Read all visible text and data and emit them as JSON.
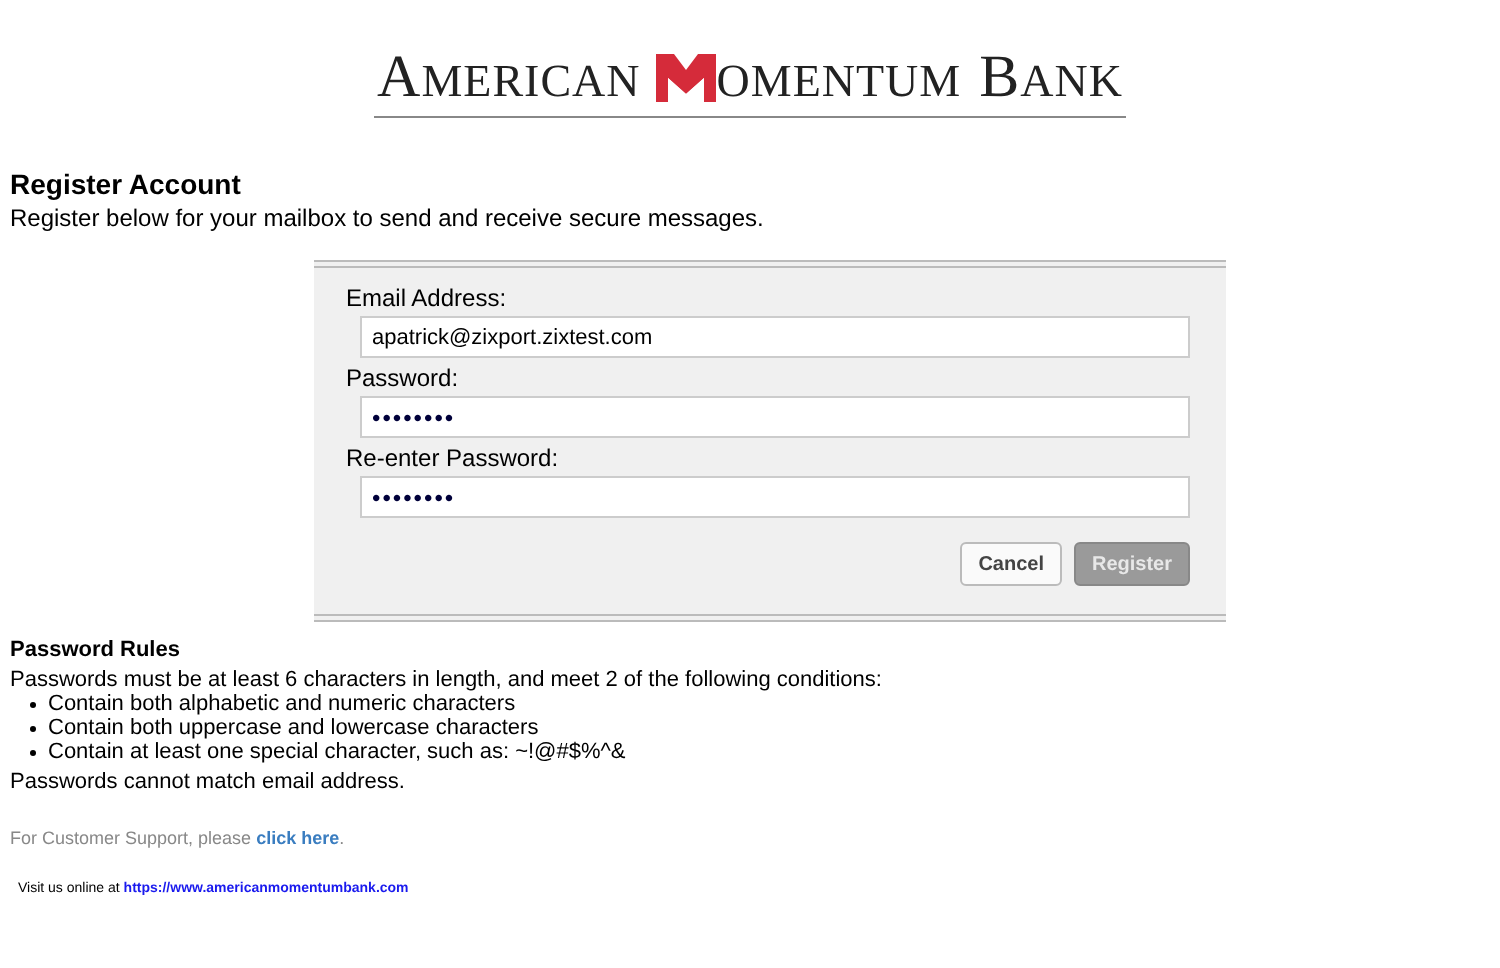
{
  "logo": {
    "word_1": "AMERICAN",
    "word_2": "OMENTUM",
    "word_3": "BANK"
  },
  "heading": "Register Account",
  "intro": "Register below for your mailbox to send and receive secure messages.",
  "form": {
    "fields": [
      {
        "label": "Email Address:",
        "value": "apatrick@zixport.zixtest.com",
        "kind": "text"
      },
      {
        "label": "Password:",
        "value": "••••••••",
        "kind": "password"
      },
      {
        "label": "Re-enter Password:",
        "value": "••••••••",
        "kind": "password"
      }
    ],
    "buttons": [
      {
        "label": "Cancel",
        "disabled": false
      },
      {
        "label": "Register",
        "disabled": true
      }
    ]
  },
  "rules": {
    "title": "Password Rules",
    "intro": "Passwords must be at least 6 characters in length, and meet 2 of the following conditions:",
    "items": [
      "Contain both alphabetic and numeric characters",
      "Contain both uppercase and lowercase characters",
      "Contain at least one special character, such as: ~!@#$%^&"
    ],
    "note": "Passwords cannot match email address."
  },
  "support": {
    "text": "For Customer Support, please ",
    "link": "click here",
    "end": "."
  },
  "footer": {
    "text": "Visit us online at ",
    "link": "https://www.americanmomentumbank.com"
  }
}
